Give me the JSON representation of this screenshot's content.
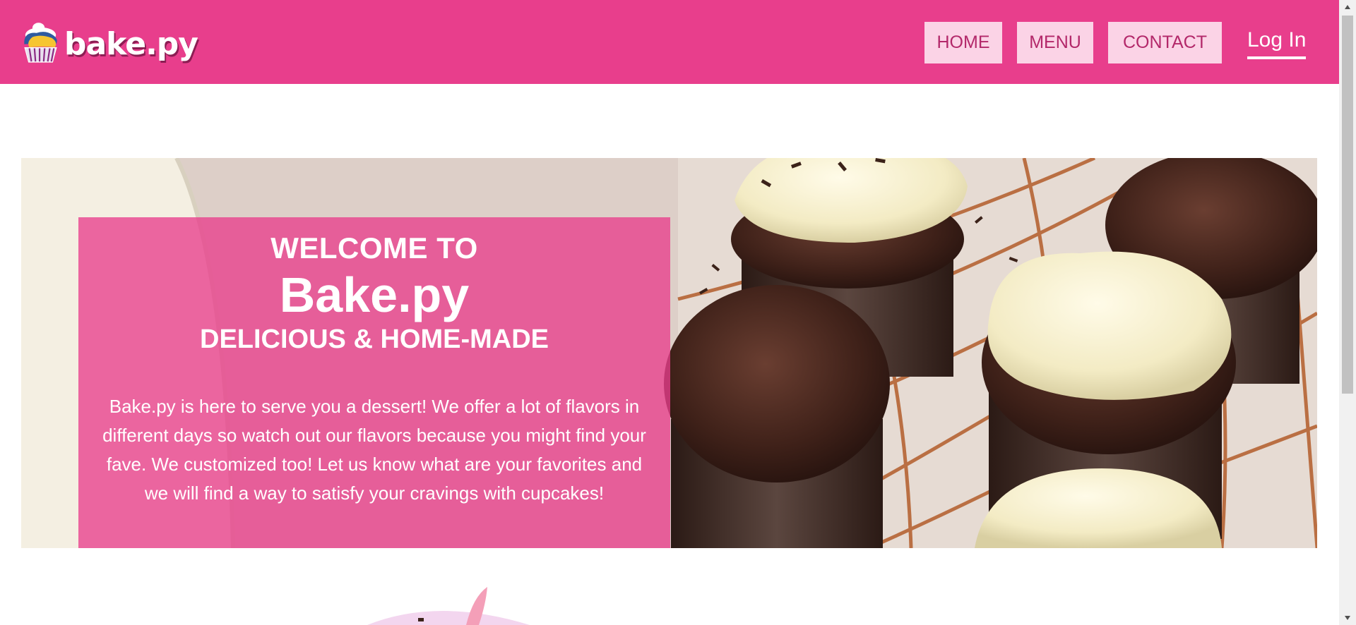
{
  "header": {
    "brand": "bake.py",
    "logo_icon": "cupcake-logo-icon",
    "nav": [
      {
        "label": "HOME"
      },
      {
        "label": "MENU"
      },
      {
        "label": "CONTACT"
      }
    ],
    "login_label": "Log In"
  },
  "hero": {
    "welcome": "WELCOME TO",
    "brand": "Bake.py",
    "tagline": "DELICIOUS & HOME-MADE",
    "description": "Bake.py is here to serve you a dessert! We offer a lot of flavors in different days so watch out our flavors because you might find your fave. We customized too! Let us know what are your favorites and we will find a way to satisfy your cravings with cupcakes!"
  },
  "colors": {
    "brand_pink": "#e83e8c",
    "nav_button_bg": "#fbd3e6",
    "nav_button_text": "#b3286a"
  }
}
